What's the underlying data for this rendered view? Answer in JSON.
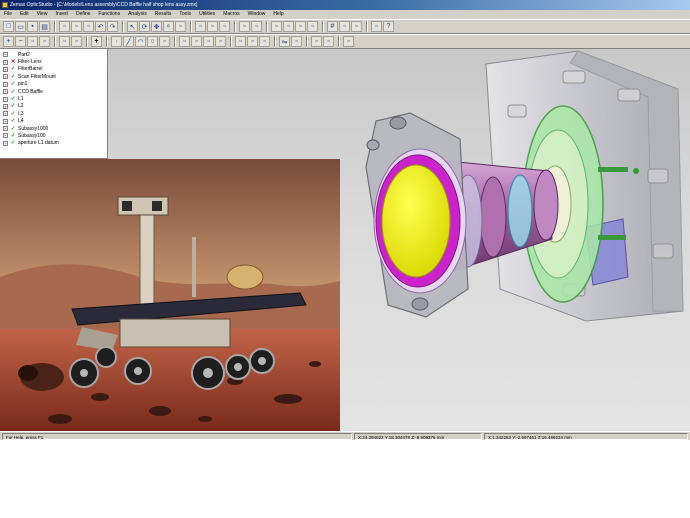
{
  "window": {
    "title": "Zemax OpticStudio - [C:\\Models\\Lens assembly\\CCD Baffle half shop lens assy.zmx]"
  },
  "menu": [
    "File",
    "Edit",
    "View",
    "Insert",
    "Define",
    "Functions",
    "Analysis",
    "Results",
    "Tools",
    "Utilities",
    "Macros",
    "Window",
    "Help"
  ],
  "toolbar": {
    "row1_icons": [
      "new-icon",
      "open-icon",
      "save-icon",
      "print-icon",
      "sep",
      "cut-icon",
      "copy-icon",
      "paste-icon",
      "undo-icon",
      "redo-icon",
      "sep",
      "pointer-icon",
      "rotate-icon",
      "pan-icon",
      "zoom-icon",
      "fit-icon",
      "sep",
      "shade-icon",
      "wire-icon",
      "hidden-icon",
      "sep",
      "layer-icon",
      "color-icon",
      "sep",
      "front-view-icon",
      "top-view-icon",
      "side-view-icon",
      "iso-view-icon",
      "sep",
      "grid-icon",
      "snap-icon",
      "measure-icon",
      "sep",
      "properties-icon",
      "help-icon"
    ],
    "row2_icons": [
      "zoom-in-icon",
      "zoom-out-icon",
      "zoom-window-icon",
      "zoom-all-icon",
      "sep",
      "orbit-icon",
      "walk-icon",
      "sep",
      "plus-icon",
      "sep",
      "point-icon",
      "line-icon",
      "arc-icon",
      "circle-icon",
      "spline-icon",
      "sep",
      "extrude-icon",
      "revolve-icon",
      "sweep-icon",
      "loft-icon",
      "sep",
      "fillet-icon",
      "chamfer-icon",
      "shell-icon",
      "sep",
      "mirror-icon",
      "pattern-icon",
      "sep",
      "boolean-icon",
      "split-icon",
      "sep",
      "render-icon"
    ],
    "row2_plus": "+"
  },
  "tree": {
    "items": [
      {
        "label": "Part2",
        "check": "none"
      },
      {
        "label": "Filter-Lens",
        "check": "x"
      },
      {
        "label": "FilterBarrel",
        "check": "ok"
      },
      {
        "label": "Scan FilterMount",
        "check": "ok"
      },
      {
        "label": "pin1",
        "check": "ok"
      },
      {
        "label": "CCD Baffle",
        "check": "ok"
      },
      {
        "label": "L1",
        "check": "ok"
      },
      {
        "label": "L2",
        "check": "ok"
      },
      {
        "label": "L3",
        "check": "ok"
      },
      {
        "label": "L4",
        "check": "ok"
      },
      {
        "label": "Subassy1000",
        "check": "ok"
      },
      {
        "label": "Subassy100",
        "check": "ok"
      },
      {
        "label": "aperture L1 datum",
        "check": "ok"
      }
    ],
    "expander": "+",
    "ok_glyph": "✓",
    "x_glyph": "✕"
  },
  "status": {
    "help": "For Help, press F1",
    "coord1": "X:24.294022 Y:18.304478 Z:-9.909376 mm",
    "coord2": "X:1.342253 Y:-2.597461 Z:16.499234 mm"
  },
  "colors": {
    "lens_face": "#e6e600",
    "lens_ring": "#cc22cc",
    "housing": "#b8b8c0",
    "flange": "#8fd88f",
    "body": "#b070b0",
    "sky": "#c9a27a",
    "ground": "#b4553a"
  }
}
